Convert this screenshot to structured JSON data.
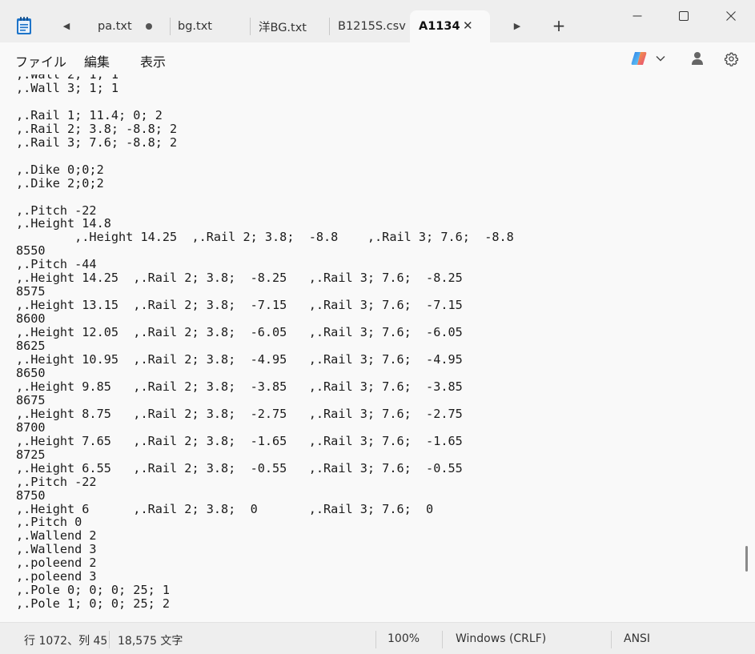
{
  "tabs": [
    {
      "label": "pa.txt",
      "modified": true
    },
    {
      "label": "bg.txt"
    },
    {
      "label": "洋BG.txt"
    },
    {
      "label": "B1215S.csv"
    },
    {
      "label": "A1134",
      "active": true
    }
  ],
  "icons": {
    "app": "notepad-icon",
    "scroll_left": "◀",
    "scroll_right": "▶",
    "new_tab": "+",
    "close_tab": "✕",
    "minimize": "—",
    "maximize": "☐",
    "close": "✕",
    "copilot": "copilot-icon",
    "chevron": "⌄",
    "account": "account-icon",
    "settings": "gear-icon"
  },
  "menu": {
    "file": "ファイル",
    "edit": "編集",
    "view": "表示"
  },
  "editor": {
    "content": ",.Wall 2; 1; 1\n,.Wall 3; 1; 1\n\n,.Rail 1; 11.4; 0; 2\n,.Rail 2; 3.8; -8.8; 2\n,.Rail 3; 7.6; -8.8; 2\n\n,.Dike 0;0;2\n,.Dike 2;0;2\n\n,.Pitch -22\n,.Height 14.8\n        ,.Height 14.25  ,.Rail 2; 3.8;  -8.8    ,.Rail 3; 7.6;  -8.8\n8550\n,.Pitch -44\n,.Height 14.25  ,.Rail 2; 3.8;  -8.25   ,.Rail 3; 7.6;  -8.25\n8575\n,.Height 13.15  ,.Rail 2; 3.8;  -7.15   ,.Rail 3; 7.6;  -7.15\n8600\n,.Height 12.05  ,.Rail 2; 3.8;  -6.05   ,.Rail 3; 7.6;  -6.05\n8625\n,.Height 10.95  ,.Rail 2; 3.8;  -4.95   ,.Rail 3; 7.6;  -4.95\n8650\n,.Height 9.85   ,.Rail 2; 3.8;  -3.85   ,.Rail 3; 7.6;  -3.85\n8675\n,.Height 8.75   ,.Rail 2; 3.8;  -2.75   ,.Rail 3; 7.6;  -2.75\n8700\n,.Height 7.65   ,.Rail 2; 3.8;  -1.65   ,.Rail 3; 7.6;  -1.65\n8725\n,.Height 6.55   ,.Rail 2; 3.8;  -0.55   ,.Rail 3; 7.6;  -0.55\n,.Pitch -22\n8750\n,.Height 6      ,.Rail 2; 3.8;  0       ,.Rail 3; 7.6;  0\n,.Pitch 0\n,.Wallend 2\n,.Wallend 3\n,.poleend 2\n,.poleend 3\n,.Pole 0; 0; 0; 25; 1\n,.Pole 1; 0; 0; 25; 2"
  },
  "status": {
    "position": "行 1072、列 45",
    "chars": "18,575 文字",
    "zoom": "100%",
    "line_ending": "Windows (CRLF)",
    "encoding": "ANSI"
  }
}
